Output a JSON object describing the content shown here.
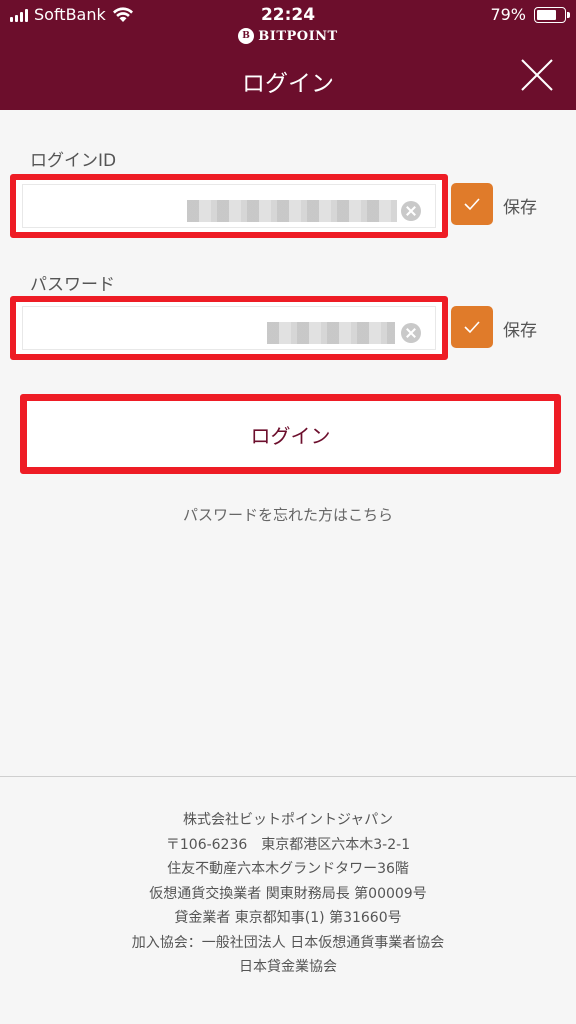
{
  "status_bar": {
    "carrier": "SoftBank",
    "time": "22:24",
    "battery": "79%",
    "battery_level": 0.79
  },
  "header": {
    "brand": "BITPOINT",
    "brand_mark": "B",
    "title": "ログイン",
    "close_icon": "close-icon"
  },
  "form": {
    "login_id_label": "ログインID",
    "password_label": "パスワード",
    "login_id_save_label": "保存",
    "password_save_label": "保存",
    "login_id_save_checked": true,
    "password_save_checked": true,
    "accent_color": "#e07b2a",
    "highlight_color": "#ee1c25"
  },
  "login_button_label": "ログイン",
  "forgot_link": "パスワードを忘れた方はこちら",
  "footer": {
    "lines": [
      "株式会社ビットポイントジャパン",
      "〒106-6236　東京都港区六本木3-2-1",
      "住友不動産六本木グランドタワー36階",
      "仮想通貨交換業者 関東財務局長 第00009号",
      "貸金業者 東京都知事(1) 第31660号",
      "加入協会：一般社団法人 日本仮想通貨事業者協会",
      "日本貸金業協会"
    ]
  },
  "colors": {
    "header_bg": "#6c0e2c",
    "page_bg": "#f6f6f6"
  }
}
